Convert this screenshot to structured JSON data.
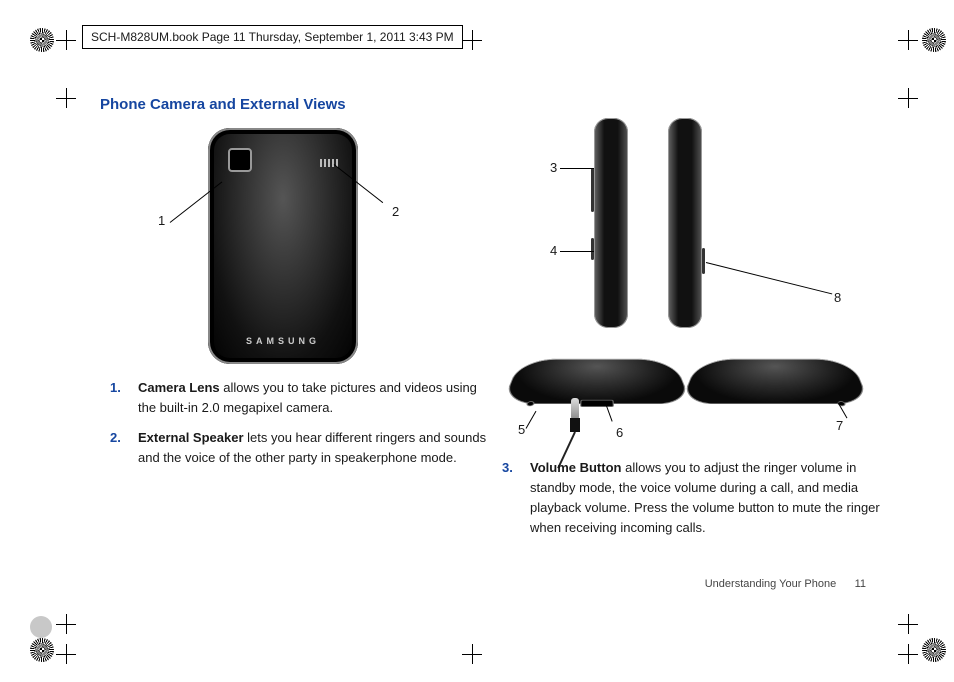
{
  "header": "SCH-M828UM.book  Page 11  Thursday, September 1, 2011  3:43 PM",
  "section_title": "Phone Camera and External Views",
  "brand": "SAMSUNG",
  "labels": {
    "n1": "1",
    "n2": "2",
    "n3": "3",
    "n4": "4",
    "n5": "5",
    "n6": "6",
    "n7": "7",
    "n8": "8"
  },
  "items": [
    {
      "num": "1.",
      "term": "Camera Lens",
      "text": " allows you to take pictures and videos using the built-in 2.0 megapixel camera."
    },
    {
      "num": "2.",
      "term": "External Speaker",
      "text": " lets you hear different ringers and sounds and the voice of the other party in speakerphone mode."
    },
    {
      "num": "3.",
      "term": "Volume Button",
      "text": " allows you to adjust the ringer volume in standby mode, the voice volume during a call, and media playback volume. Press the volume button to mute the ringer when receiving incoming calls."
    }
  ],
  "footer_section": "Understanding Your Phone",
  "footer_page": "11"
}
